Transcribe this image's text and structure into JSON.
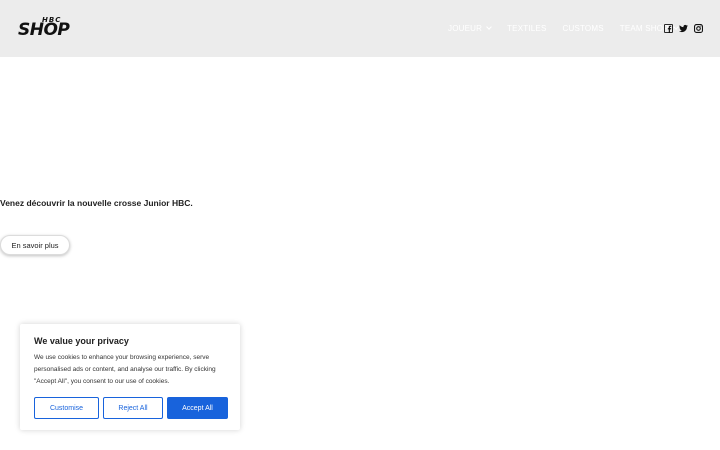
{
  "header": {
    "logo_small": "HBC",
    "logo_big": "SHOP",
    "nav": [
      {
        "label": "JOUEUR",
        "has_dropdown": true
      },
      {
        "label": "TEXTILES",
        "has_dropdown": false
      },
      {
        "label": "CUSTOMS",
        "has_dropdown": false
      },
      {
        "label": "TEAM SHOP",
        "has_dropdown": true
      }
    ],
    "social": [
      "facebook-icon",
      "twitter-icon",
      "instagram-icon"
    ]
  },
  "hero": {
    "text": "Venez découvrir la nouvelle crosse Junior HBC.",
    "button_label": "En savoir plus"
  },
  "cookie_banner": {
    "title": "We value your privacy",
    "body": "We use cookies to enhance your browsing experience, serve personalised ads or content, and analyse our traffic. By clicking \"Accept All\", you consent to our use of cookies.",
    "customise_label": "Customise",
    "reject_label": "Reject All",
    "accept_label": "Accept All"
  },
  "colors": {
    "header_bg": "#ececec",
    "accent": "#1863dc"
  }
}
